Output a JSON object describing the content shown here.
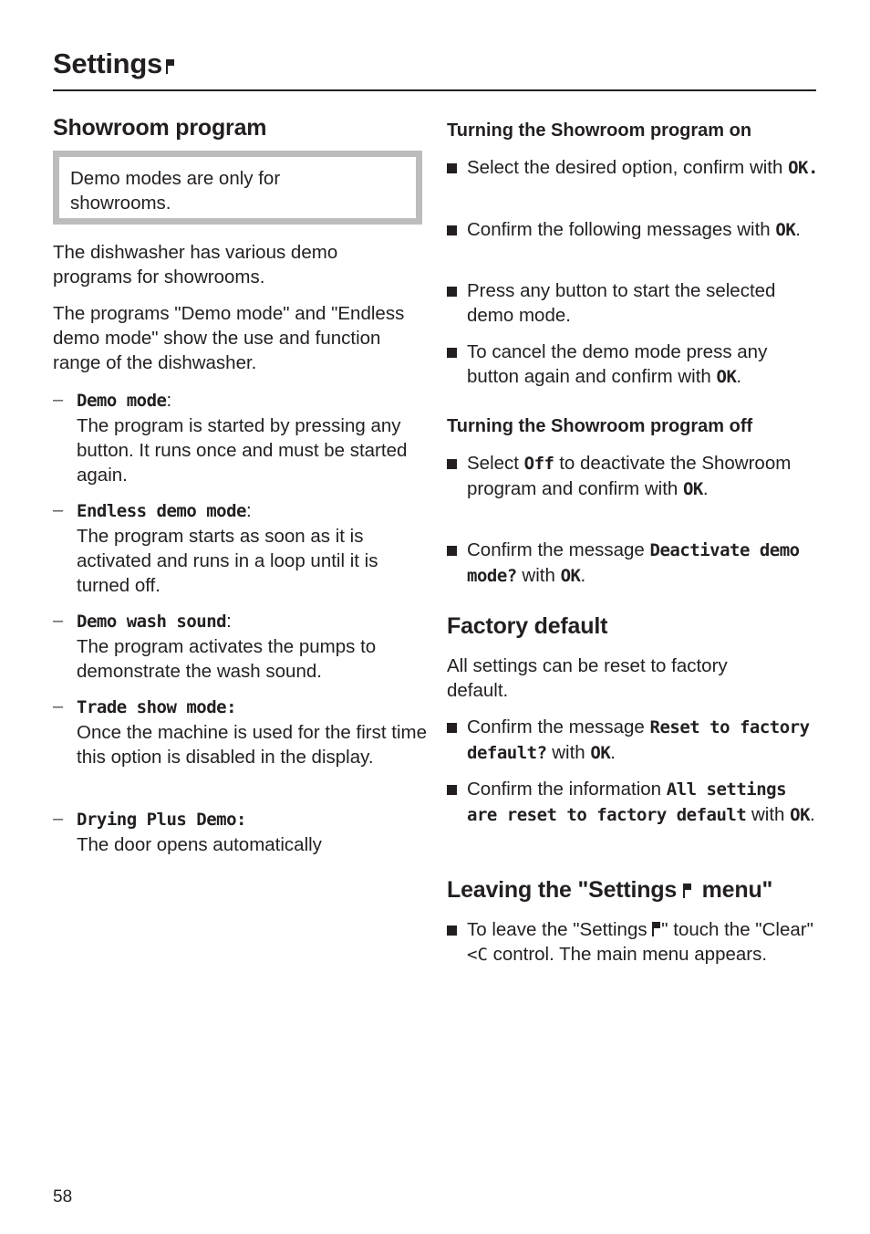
{
  "header": {
    "title": "Settings",
    "title_icon": "flag-icon"
  },
  "left": {
    "heading": "Showroom program",
    "note": "Demo modes are  only for showrooms.",
    "intro_1": "The dishwasher has various demo programs for showrooms.",
    "intro_2": "The programs \"Demo mode\" and \"Endless demo mode\" show the use and function range of the dishwasher.",
    "modes": [
      {
        "name": "Demo mode",
        "suffix": ":",
        "description": "The program is started by pressing any button. It runs once and must be started again."
      },
      {
        "name": "Endless demo mode",
        "suffix": ":",
        "description": "The program starts as soon as it is activated and runs in a loop until it is turned off."
      },
      {
        "name": "Demo wash sound",
        "suffix": ":",
        "description": "The program activates the pumps to demonstrate the wash sound."
      },
      {
        "name": "Trade show mode:",
        "suffix": "",
        "description": "Once the machine is used for the first time this option is disabled in the display."
      },
      {
        "name": "Drying Plus Demo:",
        "suffix": "",
        "description": "The door opens automatically"
      }
    ]
  },
  "right": {
    "on": {
      "heading": "Turning the Showroom program on",
      "steps": [
        {
          "pre": "Select the desired option, confirm with ",
          "lcd": "OK.",
          "post": ""
        },
        {
          "pre": "Confirm the following messages with ",
          "lcd": "OK",
          "post": "."
        },
        {
          "pre": "Press any button to start the selected demo mode.",
          "lcd": "",
          "post": ""
        },
        {
          "pre": "To cancel the demo mode press any button again and confirm with ",
          "lcd": "OK",
          "post": "."
        }
      ]
    },
    "off": {
      "heading": "Turning the Showroom program off",
      "step1_pre": "Select ",
      "step1_lcd": "Off",
      "step1_mid": "  to deactivate the Showroom program and confirm with ",
      "step1_lcd2": "OK",
      "step1_post": ".",
      "step2_pre": "Confirm the message ",
      "step2_lcd": "Deactivate demo mode?",
      "step2_mid": " with ",
      "step2_lcd2": "OK",
      "step2_post": "."
    },
    "factory": {
      "heading": "Factory default",
      "intro": "All settings can be reset to factory default.",
      "step1_pre": "Confirm the message ",
      "step1_lcd": "Reset to factory default?",
      "step1_mid": " with ",
      "step1_lcd2": "OK",
      "step1_post": ".",
      "step2_pre": "Confirm the information ",
      "step2_lcd": "All settings are reset to factory default",
      "step2_mid": " with ",
      "step2_lcd2": "OK",
      "step2_post": "."
    },
    "leaving": {
      "heading_pre": "Leaving the \"Settings ",
      "heading_post": " menu\"",
      "step_pre": "To leave the \"Settings ",
      "step_mid": "\" touch the \"Clear\"  ",
      "step_control": "<C",
      "step_post": "  control. The main menu appears."
    }
  },
  "footer": {
    "page_number": "58"
  }
}
